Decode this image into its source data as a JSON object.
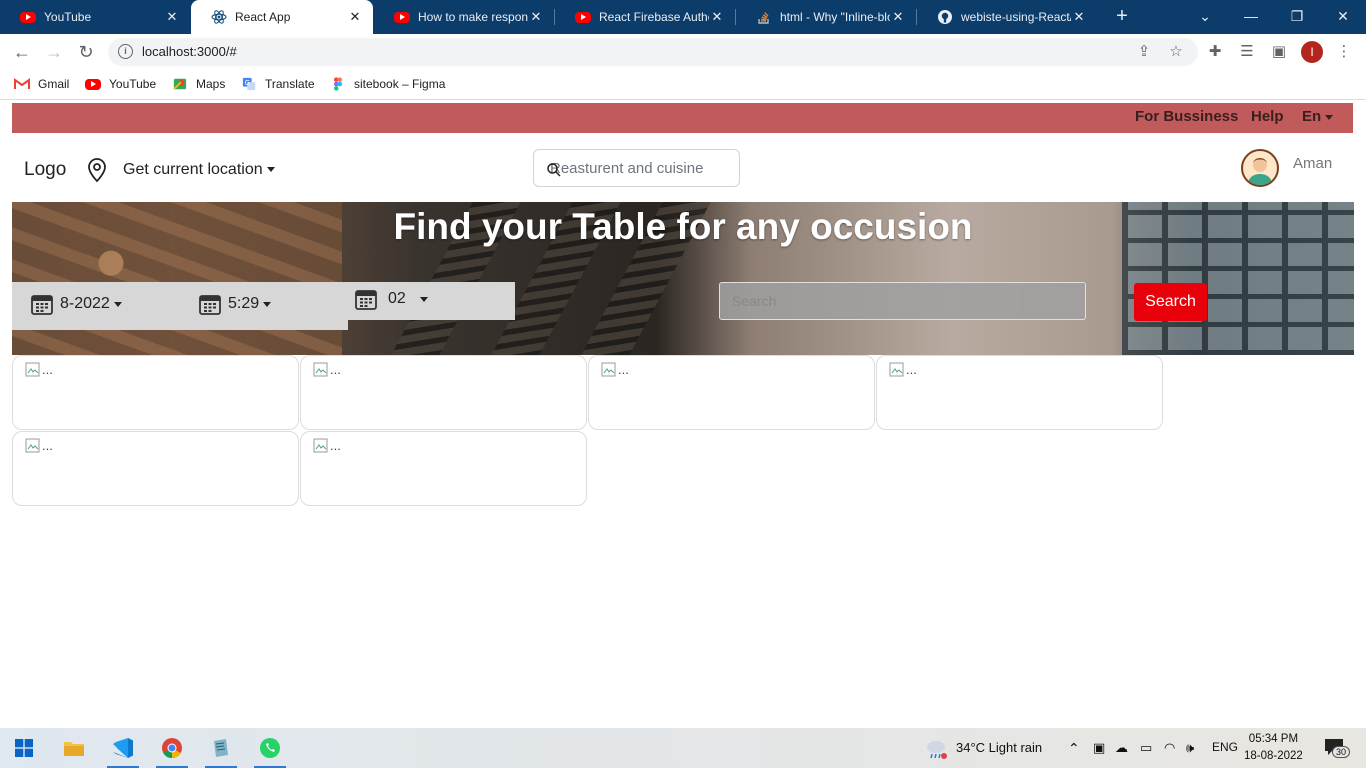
{
  "browser": {
    "tabs": [
      {
        "title": "YouTube",
        "icon": "youtube-icon",
        "active": false
      },
      {
        "title": "React App",
        "icon": "react-icon",
        "active": true
      },
      {
        "title": "How to make respons",
        "icon": "youtube-icon",
        "active": false
      },
      {
        "title": "React Firebase Authen",
        "icon": "youtube-icon",
        "active": false
      },
      {
        "title": "html - Why \"Inline-blo",
        "icon": "stackoverflow-icon",
        "active": false
      },
      {
        "title": "webiste-using-React/C",
        "icon": "github-icon",
        "active": false
      }
    ],
    "url": "localhost:3000/#",
    "profile_initial": "I",
    "bookmarks": [
      {
        "label": "Gmail",
        "icon": "gmail-icon"
      },
      {
        "label": "YouTube",
        "icon": "youtube-icon"
      },
      {
        "label": "Maps",
        "icon": "maps-icon"
      },
      {
        "label": "Translate",
        "icon": "translate-icon"
      },
      {
        "label": "sitebook – Figma",
        "icon": "figma-icon"
      }
    ]
  },
  "site": {
    "topbar": {
      "business": "For Bussiness",
      "help": "Help",
      "lang": "En",
      "color": "#c15a5a"
    },
    "header": {
      "logo": "Logo",
      "location": "Get current location",
      "search_placeholder": "Reasturent and cuisine",
      "user": "Aman"
    },
    "hero": {
      "title": "Find your Table for any occusion",
      "date": "8-2022",
      "time": "5:29",
      "party": "02",
      "search_placeholder": "Search",
      "search_button": "Search",
      "button_color": "#e8000b"
    },
    "cards": [
      {
        "alt": "..."
      },
      {
        "alt": "..."
      },
      {
        "alt": "..."
      },
      {
        "alt": "..."
      },
      {
        "alt": "..."
      },
      {
        "alt": "..."
      }
    ]
  },
  "taskbar": {
    "weather": "34°C  Light rain",
    "lang": "ENG",
    "time": "05:34 PM",
    "date": "18-08-2022",
    "notifications": "30"
  }
}
